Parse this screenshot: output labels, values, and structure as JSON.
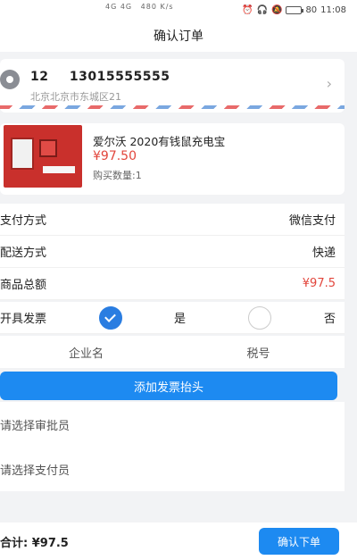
{
  "status": {
    "left_top": "4G 4G",
    "speed": "480 K/s",
    "battery": "80",
    "time": "11:08"
  },
  "nav": {
    "title": "确认订单"
  },
  "address": {
    "name": "12",
    "phone": "13015555555",
    "detail": "北京北京市东城区21"
  },
  "product": {
    "name": "爱尔沃 2020有钱鼠充电宝",
    "price": "¥97.50",
    "quantity": "购买数量:1"
  },
  "rows": {
    "payment_label": "支付方式",
    "payment_value": "微信支付",
    "delivery_label": "配送方式",
    "delivery_value": "快递",
    "total_label": "商品总额",
    "total_value": "¥97.5"
  },
  "invoice": {
    "label": "开具发票",
    "yes": "是",
    "no": "否",
    "col_company": "企业名",
    "col_tax": "税号",
    "add_button": "添加发票抬头"
  },
  "select": {
    "approver": "请选择审批员",
    "payer": "请选择支付员"
  },
  "footer": {
    "total_text": "合计: ¥97.5",
    "confirm": "确认下单"
  },
  "colors": {
    "accent": "#1d8af1",
    "price_red": "#e2463c"
  }
}
